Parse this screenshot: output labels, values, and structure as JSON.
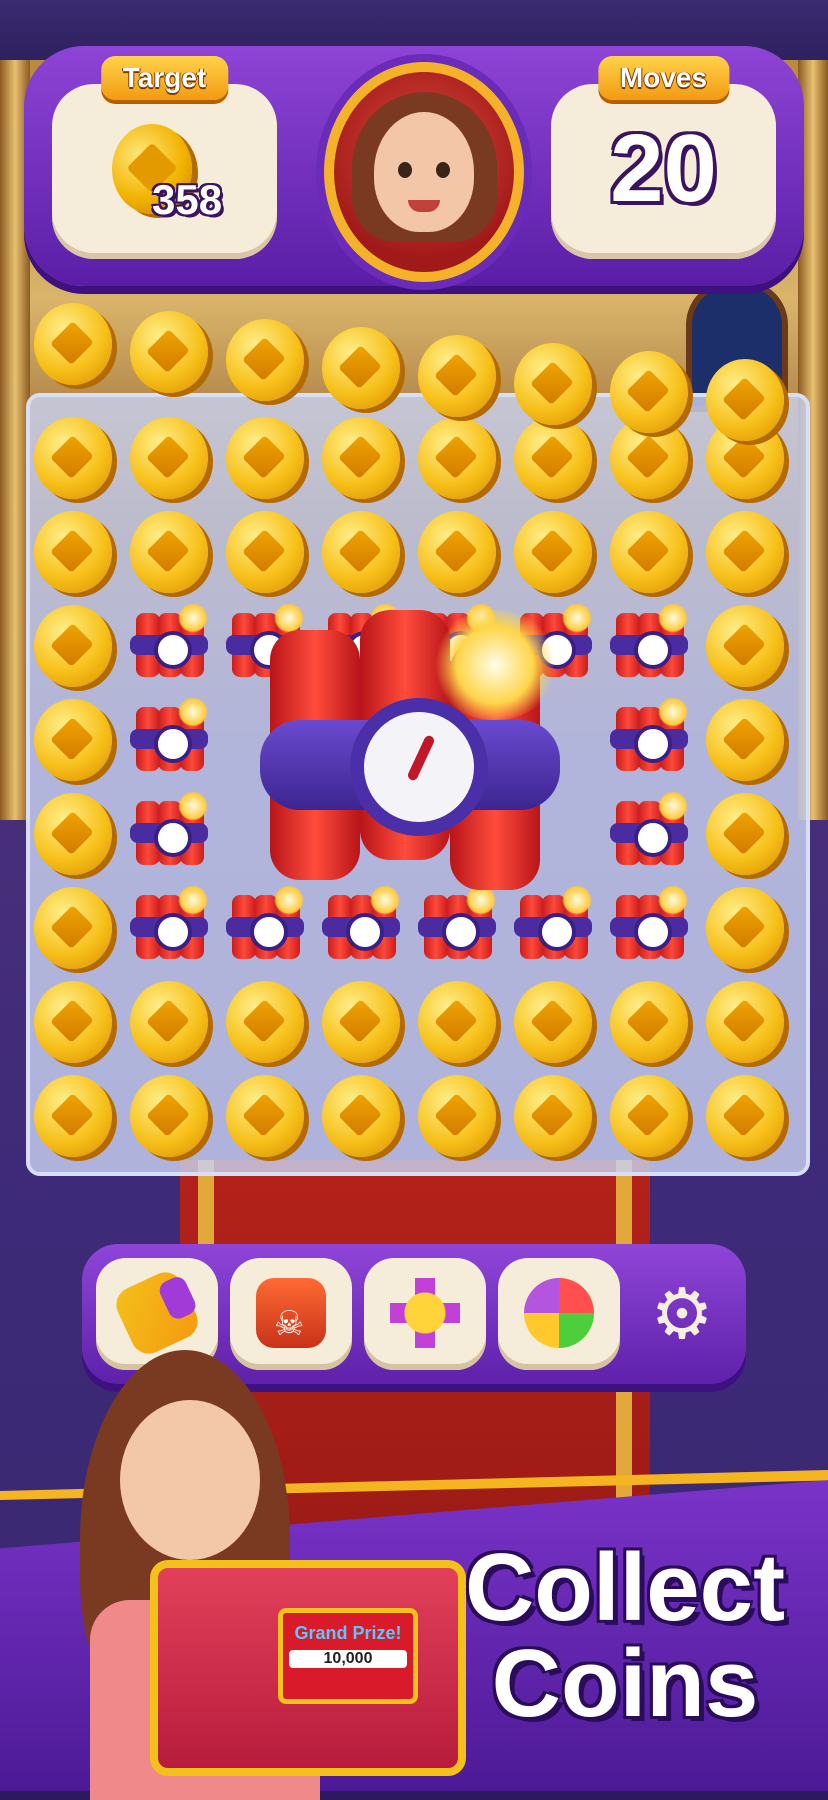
{
  "hud": {
    "target_label": "Target",
    "target_value": "358",
    "moves_label": "Moves",
    "moves_value": "20"
  },
  "board": {
    "cell_types": [
      [
        "coin",
        "coin",
        "coin",
        "coin",
        "coin",
        "coin",
        "coin",
        "coin"
      ],
      [
        "coin",
        "coin",
        "coin",
        "coin",
        "coin",
        "coin",
        "coin",
        "coin"
      ],
      [
        "coin",
        "tnt",
        "tnt",
        "tnt",
        "tnt",
        "tnt",
        "tnt",
        "coin"
      ],
      [
        "coin",
        "tnt",
        "empty",
        "empty",
        "empty",
        "empty",
        "tnt",
        "coin"
      ],
      [
        "coin",
        "tnt",
        "empty",
        "empty",
        "empty",
        "empty",
        "tnt",
        "coin"
      ],
      [
        "coin",
        "tnt",
        "tnt",
        "tnt",
        "tnt",
        "tnt",
        "tnt",
        "coin"
      ],
      [
        "coin",
        "coin",
        "coin",
        "coin",
        "coin",
        "coin",
        "coin",
        "coin"
      ],
      [
        "coin",
        "coin",
        "coin",
        "coin",
        "coin",
        "coin",
        "coin",
        "coin"
      ]
    ],
    "falling_coins_row": 8
  },
  "boosters": [
    {
      "name": "hammer-icon"
    },
    {
      "name": "bomb-icon"
    },
    {
      "name": "cross-blast-icon"
    },
    {
      "name": "pinwheel-icon"
    }
  ],
  "settings_icon": "gear-icon",
  "banner": {
    "line1": "Collect",
    "line2": "Coins",
    "prize_title": "Grand Prize!",
    "prize_amount": "10,000"
  }
}
